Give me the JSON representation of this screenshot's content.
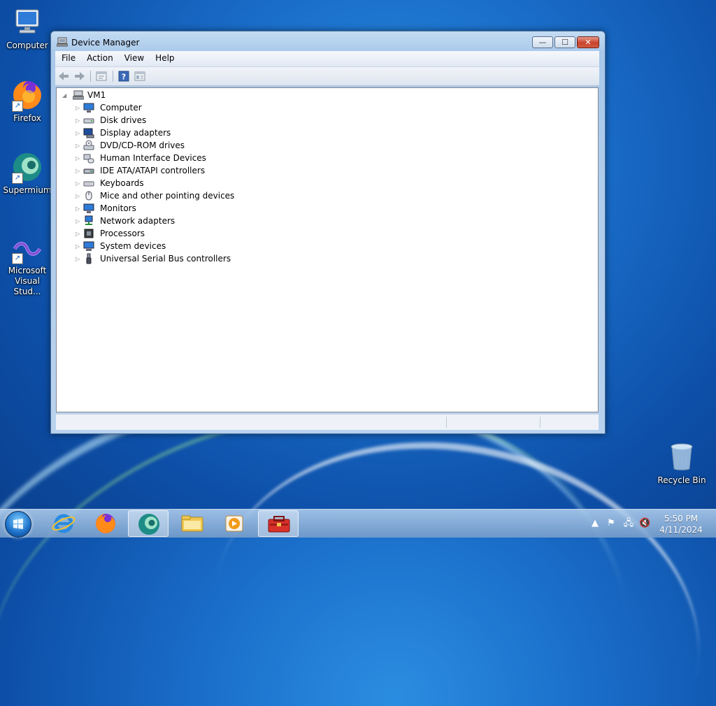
{
  "desktop": {
    "icons": [
      {
        "label": "Computer"
      },
      {
        "label": "Firefox"
      },
      {
        "label": "Supermium"
      },
      {
        "label": "Microsoft Visual Stud..."
      },
      {
        "label": "Recycle Bin"
      }
    ]
  },
  "window": {
    "title": "Device Manager",
    "controls": {
      "minimize": "—",
      "maximize": "☐",
      "close": "✕"
    },
    "menu": [
      "File",
      "Action",
      "View",
      "Help"
    ],
    "toolbar": [
      "back-icon",
      "forward-icon",
      "properties-icon",
      "help-icon",
      "view-icon"
    ],
    "tree": {
      "root": "VM1",
      "root_expander": "◢",
      "collapsed_expander": "▷",
      "categories": [
        {
          "label": "Computer",
          "icon": "computer-icon"
        },
        {
          "label": "Disk drives",
          "icon": "disk-drive-icon"
        },
        {
          "label": "Display adapters",
          "icon": "display-adapter-icon"
        },
        {
          "label": "DVD/CD-ROM drives",
          "icon": "dvd-drive-icon"
        },
        {
          "label": "Human Interface Devices",
          "icon": "hid-icon"
        },
        {
          "label": "IDE ATA/ATAPI controllers",
          "icon": "ide-controller-icon"
        },
        {
          "label": "Keyboards",
          "icon": "keyboard-icon"
        },
        {
          "label": "Mice and other pointing devices",
          "icon": "mouse-icon"
        },
        {
          "label": "Monitors",
          "icon": "monitor-icon"
        },
        {
          "label": "Network adapters",
          "icon": "network-adapter-icon"
        },
        {
          "label": "Processors",
          "icon": "processor-icon"
        },
        {
          "label": "System devices",
          "icon": "system-devices-icon"
        },
        {
          "label": "Universal Serial Bus controllers",
          "icon": "usb-icon"
        }
      ]
    }
  },
  "taskbar": {
    "pinned": [
      "internet-explorer-icon",
      "firefox-icon",
      "supermium-icon",
      "file-explorer-icon",
      "media-player-icon",
      "device-manager-icon"
    ],
    "tray": {
      "show_hidden": "▲",
      "flag": "⚑",
      "network": "🖧",
      "volume": "🔇"
    },
    "clock": {
      "time": "5:50 PM",
      "date": "4/11/2024"
    }
  },
  "colors": {
    "accent": "#1a6ec9",
    "close_button": "#c7432d"
  }
}
